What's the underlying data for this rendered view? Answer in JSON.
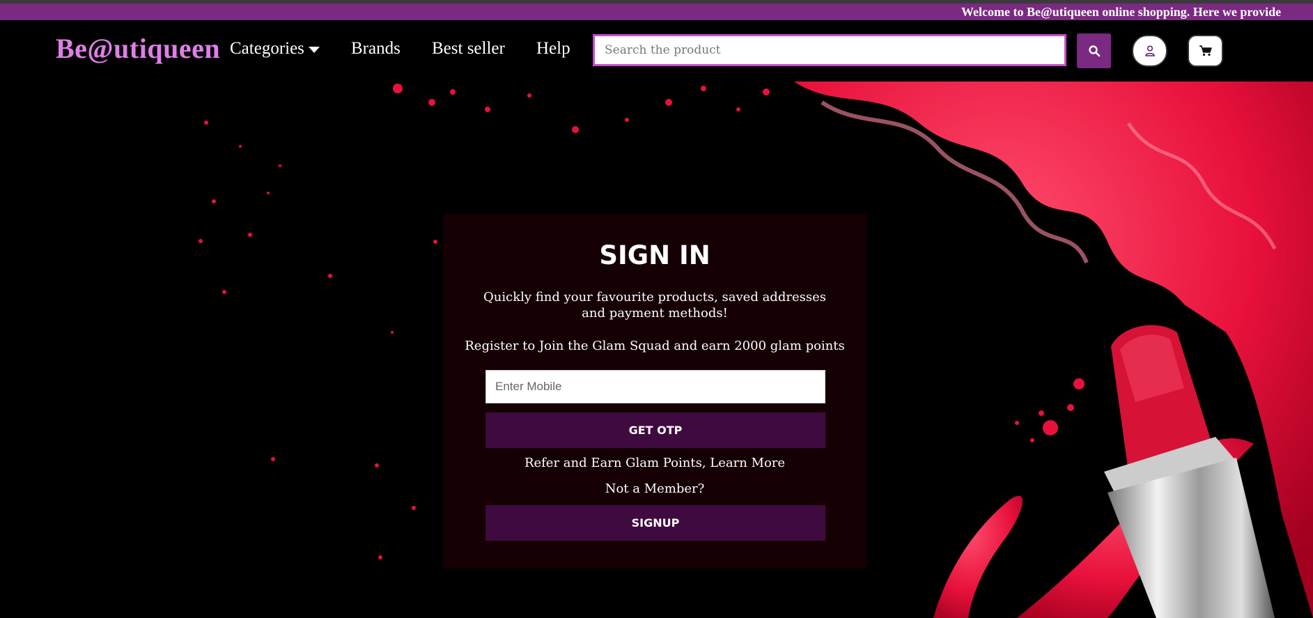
{
  "marquee": {
    "text": "Welcome to Be@utiqueen online shopping. Here we provide"
  },
  "header": {
    "logo": "Be@utiqueen",
    "nav": {
      "categories": "Categories",
      "brands": "Brands",
      "best_seller": "Best seller",
      "help": "Help"
    },
    "search": {
      "placeholder": "Search the product"
    },
    "icons": {
      "search": "search-icon",
      "account": "user-icon",
      "cart": "cart-icon"
    }
  },
  "signin": {
    "title": "SIGN IN",
    "description": "Quickly find your favourite products, saved addresses and payment methods!",
    "register_text": "Register to Join the Glam Squad and earn 2000 glam points",
    "mobile_placeholder": "Enter Mobile",
    "otp_button": "GET OTP",
    "refer_text": "Refer and Earn Glam Points, Learn More",
    "not_member": "Not a Member?",
    "signup_button": "SIGNUP"
  },
  "colors": {
    "brand_purple": "#7a2a80",
    "logo_pink": "#e07ee8",
    "button_dark_purple": "#3f0a3f",
    "card_bg": "#150003",
    "lipstick_red": "#e8113c"
  }
}
